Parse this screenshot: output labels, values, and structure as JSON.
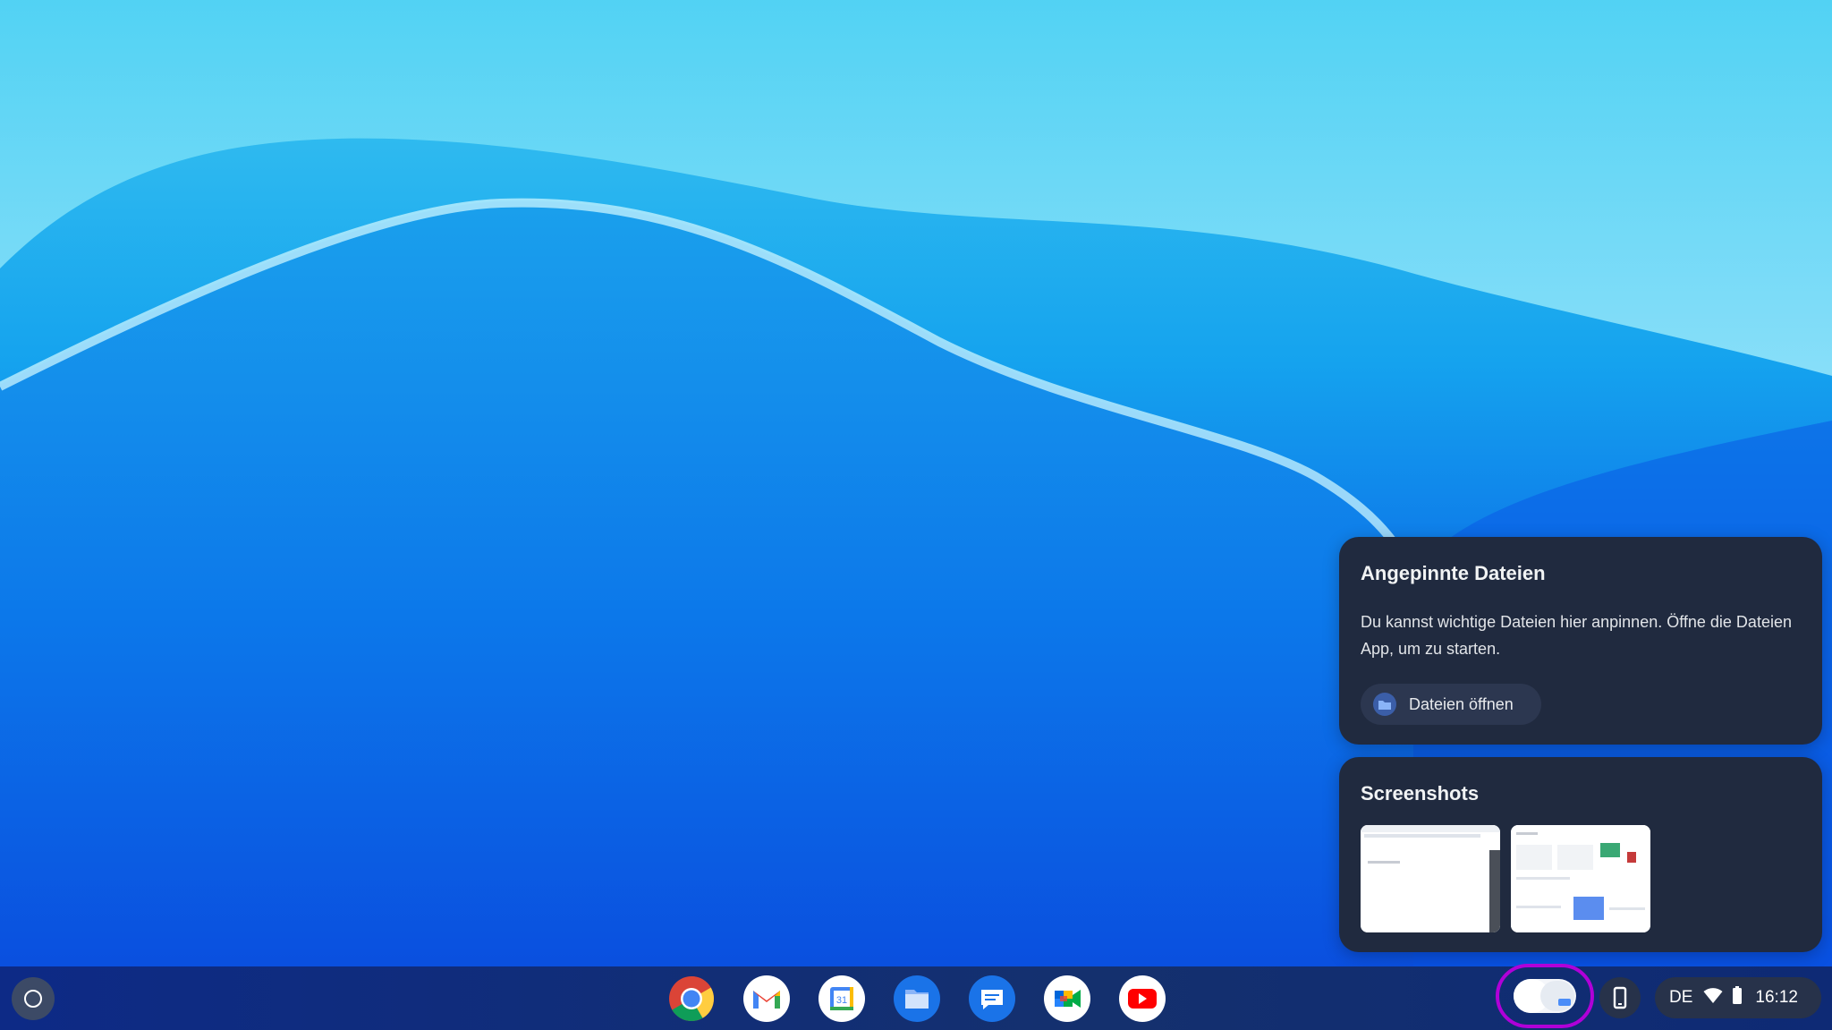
{
  "desktop": {
    "wallpaper": "blue-wave"
  },
  "holding_space": {
    "pinned": {
      "title": "Angepinnte Dateien",
      "description": "Du kannst wichtige Dateien hier anpinnen. Öffne die Dateien App, um zu starten.",
      "open_button_label": "Dateien öffnen",
      "open_button_icon": "folder-icon"
    },
    "screenshots": {
      "title": "Screenshots",
      "items": [
        "screenshot-thumbnail-1",
        "screenshot-thumbnail-2"
      ]
    }
  },
  "shelf": {
    "launcher_icon": "launcher-icon",
    "apps": [
      "Chrome",
      "Gmail",
      "Calendar",
      "Files",
      "Messages",
      "Meet",
      "YouTube"
    ],
    "status": {
      "keyboard_layout": "DE",
      "time": "16:12",
      "icons": [
        "wifi-icon",
        "battery-icon"
      ]
    },
    "highlight_color": "#b000d8"
  }
}
